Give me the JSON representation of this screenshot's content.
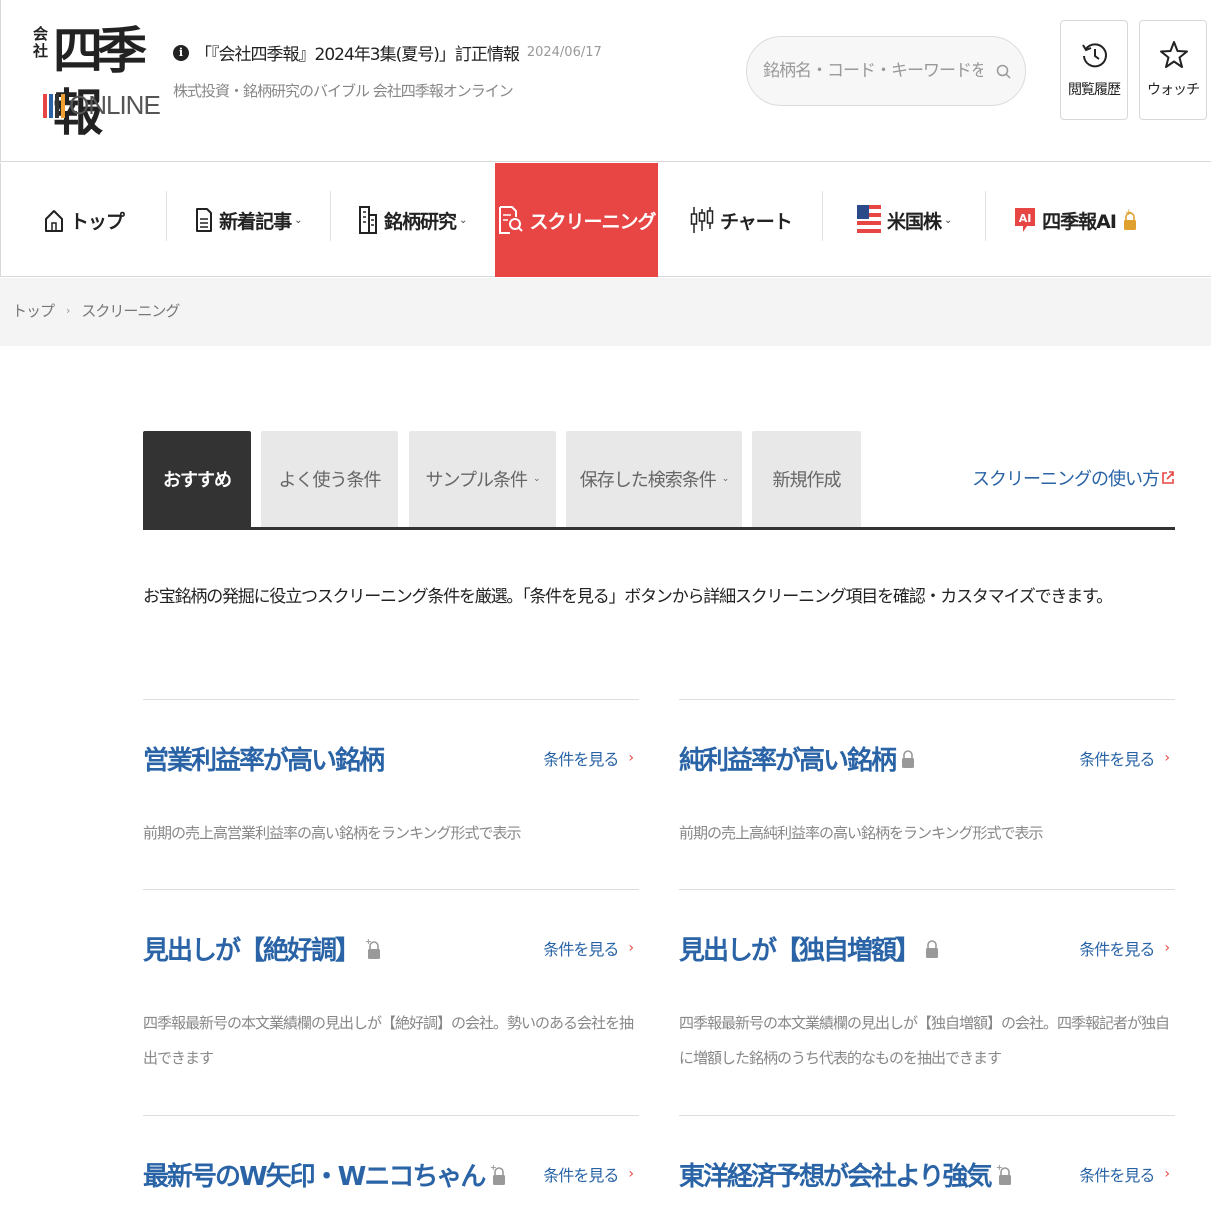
{
  "header": {
    "logo_small": "会社",
    "logo_main": "四季報",
    "logo_online": "ONLINE",
    "logo_bar_colors": [
      "#e84545",
      "#2a64a6",
      "#333333",
      "#f0a030"
    ],
    "notice_text": "「『会社四季報』2024年3集(夏号)」訂正情報",
    "notice_date": "2024/06/17",
    "tagline": "株式投資・銘柄研究のバイブル 会社四季報オンライン",
    "search_placeholder": "銘柄名・コード・キーワードを入力",
    "history_label": "閲覧履歴",
    "watch_label": "ウォッチ"
  },
  "nav": {
    "items": [
      {
        "label": "トップ",
        "icon": "home-icon"
      },
      {
        "label": "新着記事",
        "icon": "document-icon"
      },
      {
        "label": "銘柄研究",
        "icon": "building-icon"
      },
      {
        "label": "スクリーニング",
        "icon": "screening-icon"
      },
      {
        "label": "チャート",
        "icon": "candlestick-icon"
      },
      {
        "label": "米国株",
        "icon": "us-flag-icon"
      },
      {
        "label": "四季報AI",
        "icon": "ai-icon"
      }
    ],
    "active_color": "#e84545"
  },
  "breadcrumb": {
    "items": [
      "トップ",
      "スクリーニング"
    ],
    "separator": "›"
  },
  "tabs": {
    "items": [
      "おすすめ",
      "よく使う条件",
      "サンプル条件",
      "保存した検索条件",
      "新規作成"
    ],
    "active": "おすすめ",
    "howto_label": "スクリーニングの使い方"
  },
  "description": "お宝銘柄の発掘に役立つスクリーニング条件を厳選。「条件を見る」ボタンから詳細スクリーニング項目を確認・カスタマイズできます。",
  "cards": [
    {
      "title": "営業利益率が高い銘柄",
      "locked": false,
      "link": "条件を見る",
      "text": "前期の売上高営業利益率の高い銘柄をランキング形式で表示"
    },
    {
      "title": "純利益率が高い銘柄",
      "locked": true,
      "link": "条件を見る",
      "text": "前期の売上高純利益率の高い銘柄をランキング形式で表示"
    },
    {
      "title": "見出しが【絶好調】",
      "locked": true,
      "link": "条件を見る",
      "text": "四季報最新号の本文業績欄の見出しが【絶好調】の会社。勢いのある会社を抽出できます"
    },
    {
      "title": "見出しが【独自増額】",
      "locked": true,
      "link": "条件を見る",
      "text": "四季報最新号の本文業績欄の見出しが【独自増額】の会社。四季報記者が独自に増額した銘柄のうち代表的なものを抽出できます"
    },
    {
      "title": "最新号のW矢印・Wニコちゃん",
      "locked": true,
      "link": "条件を見る",
      "text": ""
    },
    {
      "title": "東洋経済予想が会社より強気",
      "locked": true,
      "link": "条件を見る",
      "text": ""
    }
  ]
}
